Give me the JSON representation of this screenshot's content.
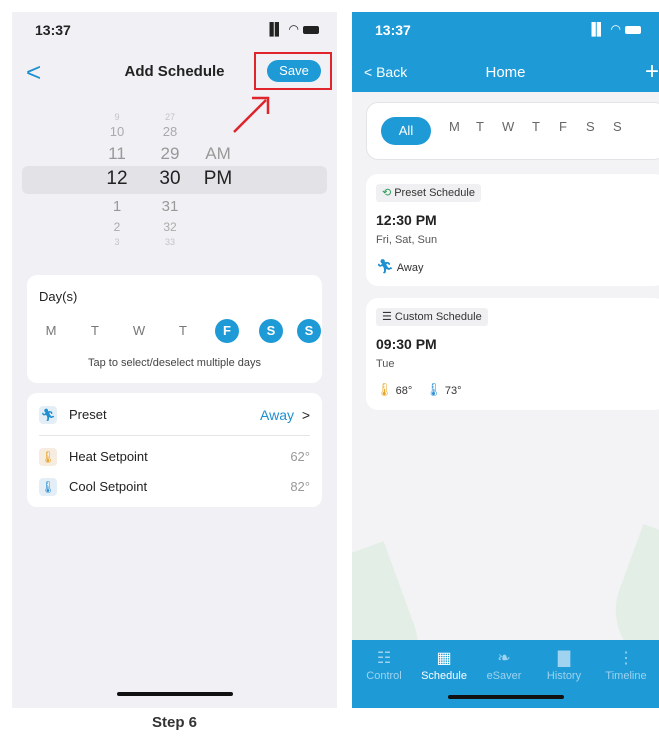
{
  "left_phone": {
    "status_time": "13:37",
    "status_icons": "▐▌ ◠",
    "nav": {
      "back": "<",
      "title": "Add Schedule",
      "save_label": "Save"
    },
    "picker": {
      "hours": [
        "9",
        "10",
        "11",
        "12",
        "1",
        "2",
        "3"
      ],
      "minutes": [
        "27",
        "28",
        "29",
        "30",
        "31",
        "32",
        "33"
      ],
      "ampm": [
        "AM",
        "PM"
      ]
    },
    "days": {
      "label": "Day(s)",
      "items": [
        {
          "letter": "M",
          "selected": false
        },
        {
          "letter": "T",
          "selected": false
        },
        {
          "letter": "W",
          "selected": false
        },
        {
          "letter": "T",
          "selected": false
        },
        {
          "letter": "F",
          "selected": true
        },
        {
          "letter": "S",
          "selected": true
        },
        {
          "letter": "S",
          "selected": true
        }
      ],
      "hint": "Tap to select/deselect multiple days"
    },
    "settings": {
      "preset_label": "Preset",
      "preset_value": "Away",
      "preset_chevron": ">",
      "heat_label": "Heat Setpoint",
      "heat_value": "62°",
      "cool_label": "Cool Setpoint",
      "cool_value": "82°"
    },
    "step_label": "Step 6"
  },
  "right_phone": {
    "status_time": "13:37",
    "status_icons": "▐▌ ◠",
    "nav": {
      "back": "< Back",
      "title": "Home",
      "plus": "+"
    },
    "filters": [
      "All",
      "M",
      "T",
      "W",
      "T",
      "F",
      "S",
      "S"
    ],
    "schedules": [
      {
        "tag": "Preset Schedule",
        "time": "12:30 PM",
        "days": "Fri, Sat, Sun",
        "mode": "Away"
      },
      {
        "tag": "Custom Schedule",
        "time": "09:30 PM",
        "days": "Tue",
        "heat": "68°",
        "cool": "73°"
      }
    ],
    "tabs": [
      {
        "label": "Control",
        "icon": "sliders-icon",
        "active": false
      },
      {
        "label": "Schedule",
        "icon": "calendar-icon",
        "active": true
      },
      {
        "label": "eSaver",
        "icon": "leaf-icon",
        "active": false
      },
      {
        "label": "History",
        "icon": "bar-chart-icon",
        "active": false
      },
      {
        "label": "Timeline",
        "icon": "timeline-icon",
        "active": false
      }
    ]
  },
  "colors": {
    "accent": "#1e9ad6",
    "highlight": "#e0242b"
  }
}
